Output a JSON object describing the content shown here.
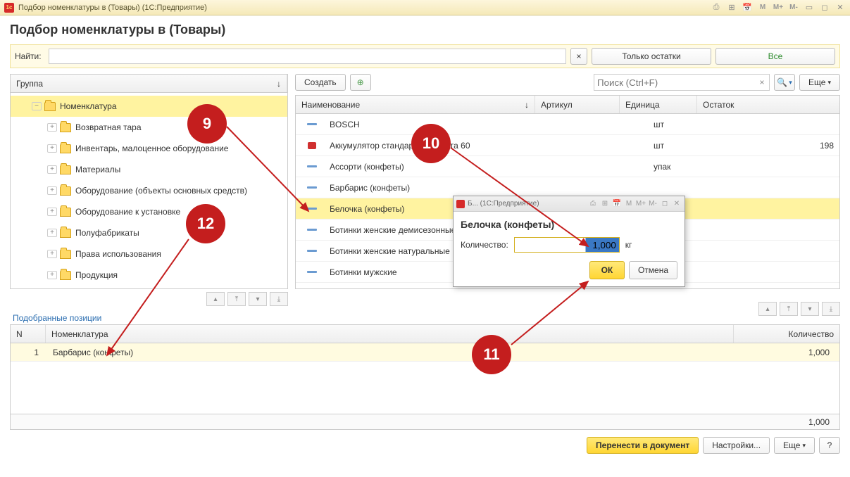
{
  "titlebar": {
    "app": "1с",
    "title": "Подбор номенклатуры в  (Товары)  (1С:Предприятие)",
    "m_labels": [
      "M",
      "M+",
      "M-"
    ]
  },
  "page": {
    "title": "Подбор номенклатуры в  (Товары)"
  },
  "search": {
    "label": "Найти:",
    "value": "",
    "only_stock": "Только остатки",
    "all": "Все"
  },
  "tree": {
    "header": "Группа",
    "root": "Номенклатура",
    "items": [
      "Возвратная тара",
      "Инвентарь, малоценное оборудование",
      "Материалы",
      "Оборудование (объекты основных средств)",
      "Оборудование к установке",
      "Полуфабрикаты",
      "Права использования",
      "Продукция"
    ]
  },
  "rightbar": {
    "create": "Создать",
    "search_ph": "Поиск (Ctrl+F)",
    "more": "Еще"
  },
  "grid": {
    "cols": {
      "name": "Наименование",
      "art": "Артикул",
      "unit": "Единица",
      "rest": "Остаток"
    },
    "rows": [
      {
        "name": "BOSCH",
        "art": "",
        "unit": "шт",
        "rest": ""
      },
      {
        "name": "Аккумулятор стандартный Варта 60",
        "art": "",
        "unit": "шт",
        "rest": "198",
        "icon": "red"
      },
      {
        "name": "Ассорти (конфеты)",
        "art": "",
        "unit": "упак",
        "rest": ""
      },
      {
        "name": "Барбарис (конфеты)",
        "art": "",
        "unit": "",
        "rest": ""
      },
      {
        "name": "Белочка (конфеты)",
        "art": "",
        "unit": "",
        "rest": "",
        "selected": true
      },
      {
        "name": "Ботинки женские демисезонные",
        "art": "",
        "unit": "",
        "rest": ""
      },
      {
        "name": "Ботинки женские натуральные",
        "art": "",
        "unit": "",
        "rest": ""
      },
      {
        "name": "Ботинки мужские",
        "art": "",
        "unit": "",
        "rest": ""
      }
    ]
  },
  "selected": {
    "title": "Подобранные позиции",
    "cols": {
      "n": "N",
      "nom": "Номенклатура",
      "qty": "Количество"
    },
    "rows": [
      {
        "n": "1",
        "nom": "Барбарис (конфеты)",
        "qty": "1,000"
      }
    ],
    "total": "1,000"
  },
  "footer": {
    "transfer": "Перенести в документ",
    "settings": "Настройки...",
    "more": "Еще",
    "help": "?"
  },
  "dialog": {
    "titlebar": "Б...  (1С:Предприятие)",
    "name": "Белочка (конфеты)",
    "qty_label": "Количество:",
    "qty_value": "1,000",
    "unit": "кг",
    "ok": "ОК",
    "cancel": "Отмена"
  },
  "annotations": {
    "a9": "9",
    "a10": "10",
    "a11": "11",
    "a12": "12"
  }
}
